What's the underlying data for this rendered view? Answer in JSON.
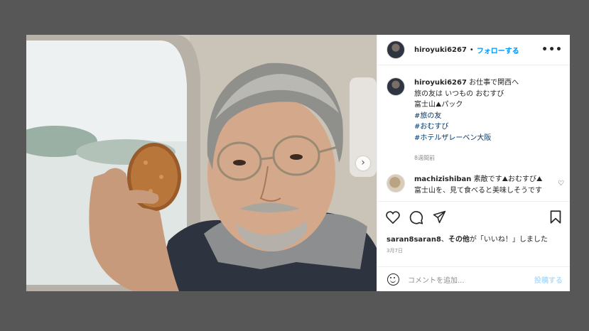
{
  "post": {
    "username": "hiroyuki6267",
    "separator": "•",
    "follow_label": "フォローする",
    "more_label": "•••",
    "next_label": "›"
  },
  "caption": {
    "username": "hiroyuki6267",
    "line1": "お仕事で関西へ",
    "line2": "旅の友は いつもの おむすび",
    "line3": "富士山⛰パック",
    "hashtags": [
      "#旅の友",
      "#おむすび",
      "#ホテルザレーベン大阪"
    ],
    "time_ago": "8週間前"
  },
  "comment": {
    "username": "machizishiban",
    "text": "素敵です⛰おむすび⛰富士山を、見て食べると美味しそうです"
  },
  "likes": {
    "user": "saran8saran8",
    "text_bold": "その他",
    "text_rest": "が「いいね！」しました"
  },
  "date": "3月7日",
  "add_comment": {
    "placeholder": "コメントを追加...",
    "post_label": "投稿する"
  },
  "colors": {
    "accent": "#0095f6",
    "hashtag": "#00376b",
    "background": "#575757"
  }
}
